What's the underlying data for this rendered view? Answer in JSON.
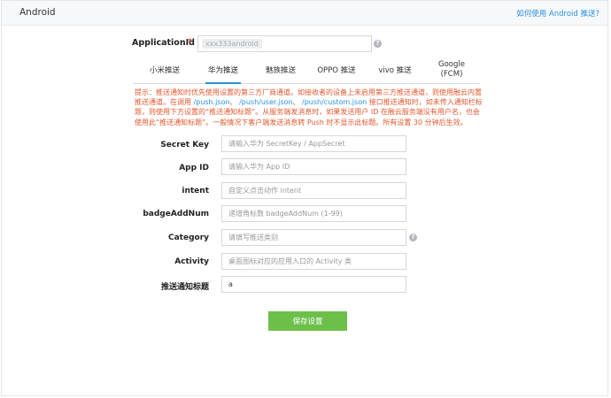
{
  "header": {
    "title": "Android",
    "help_link": "如何使用 Android 推送?"
  },
  "app": {
    "label": "ApplicationId",
    "required_mark": "*",
    "value": "xxx333android"
  },
  "tabs": [
    {
      "label": "小米推送"
    },
    {
      "label": "华为推送"
    },
    {
      "label": "魅族推送"
    },
    {
      "label": "OPPO 推送"
    },
    {
      "label": "vivo 推送"
    },
    {
      "label": "Google",
      "label2": "(FCM)"
    }
  ],
  "active_tab": "华为推送",
  "notice": {
    "p1": "提示：推送通知时优先使用设置的第三方厂商通道。如接收者的设备上未启用第三方推送通道，则使用融云内置推送通道。在调用 ",
    "api1": "/push.json",
    "sep1": "、 ",
    "api2": "/push/user.json",
    "sep2": "、 ",
    "api3": "/push/custom.json",
    "p2": " 接口推送通知时，如未传入通知栏标题，则使用下方设置的“推送通知标题”。从服务端发消息时，如果发送用户 ID 在融云服务端没有用户名，也会使用此“推送通知标题”。一般情况下客户端发送消息转 Push 时不显示此标题。所有设置 30 分钟后生效。"
  },
  "fields": {
    "secret_key": {
      "label": "Secret Key",
      "placeholder": "请输入华为 SecretKey / AppSecret",
      "value": ""
    },
    "app_id": {
      "label": "App ID",
      "placeholder": "请输入华为 App ID",
      "value": ""
    },
    "intent": {
      "label": "intent",
      "placeholder": "自定义点击动作 intent",
      "value": ""
    },
    "badge": {
      "label": "badgeAddNum",
      "placeholder": "递增角标数 badgeAddNum (1-99)",
      "value": ""
    },
    "category": {
      "label": "Category",
      "placeholder": "请填写推送类别",
      "value": ""
    },
    "activity": {
      "label": "Activity",
      "placeholder": "桌面图标对应的应用入口的 Activity 类",
      "value": ""
    },
    "title": {
      "label": "推送通知标题",
      "placeholder": "",
      "value": "a"
    }
  },
  "save_label": "保存设置",
  "colors": {
    "accent": "#2a90e0",
    "notice": "#e4572e",
    "save": "#6cc04a",
    "required": "#e02020"
  },
  "icons": {
    "help": "help-circle-icon"
  }
}
